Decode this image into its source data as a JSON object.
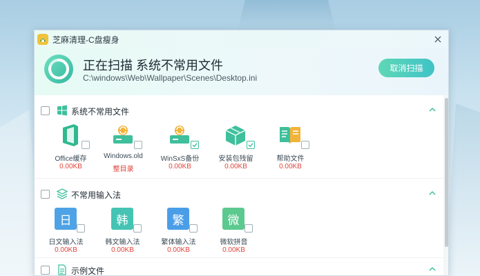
{
  "window": {
    "title": "芝麻清理-C盘瘦身"
  },
  "scan": {
    "title": "正在扫描 系统不常用文件",
    "path": "C:\\windows\\Web\\Wallpaper\\Scenes\\Desktop.ini",
    "cancel_label": "取消扫描"
  },
  "sections": [
    {
      "title": "系统不常用文件",
      "items": [
        {
          "name": "Office缓存",
          "size": "0.00KB",
          "icon": "office-icon",
          "checked": false
        },
        {
          "name": "Windows.old",
          "size": "整目录",
          "icon": "windows-old-icon",
          "checked": false
        },
        {
          "name": "WinSxS备份",
          "size": "0.00KB",
          "icon": "winsxs-backup-icon",
          "checked": true
        },
        {
          "name": "安装包残留",
          "size": "0.00KB",
          "icon": "package-box-icon",
          "checked": true
        },
        {
          "name": "帮助文件",
          "size": "0.00KB",
          "icon": "help-book-icon",
          "checked": false
        }
      ]
    },
    {
      "title": "不常用输入法",
      "items": [
        {
          "name": "日文输入法",
          "size": "0.00KB",
          "glyph": "日",
          "color": "#4da3e6",
          "checked": false
        },
        {
          "name": "韩文输入法",
          "size": "0.00KB",
          "glyph": "韩",
          "color": "#45c4b4",
          "checked": false
        },
        {
          "name": "繁体输入法",
          "size": "0.00KB",
          "glyph": "繁",
          "color": "#4a9ee8",
          "checked": false
        },
        {
          "name": "微软拼音",
          "size": "0.00KB",
          "glyph": "微",
          "color": "#5cc98f",
          "checked": false
        }
      ]
    },
    {
      "title": "示例文件"
    }
  ],
  "colors": {
    "accent": "#4fcfb8",
    "size_text": "#e0443a"
  }
}
